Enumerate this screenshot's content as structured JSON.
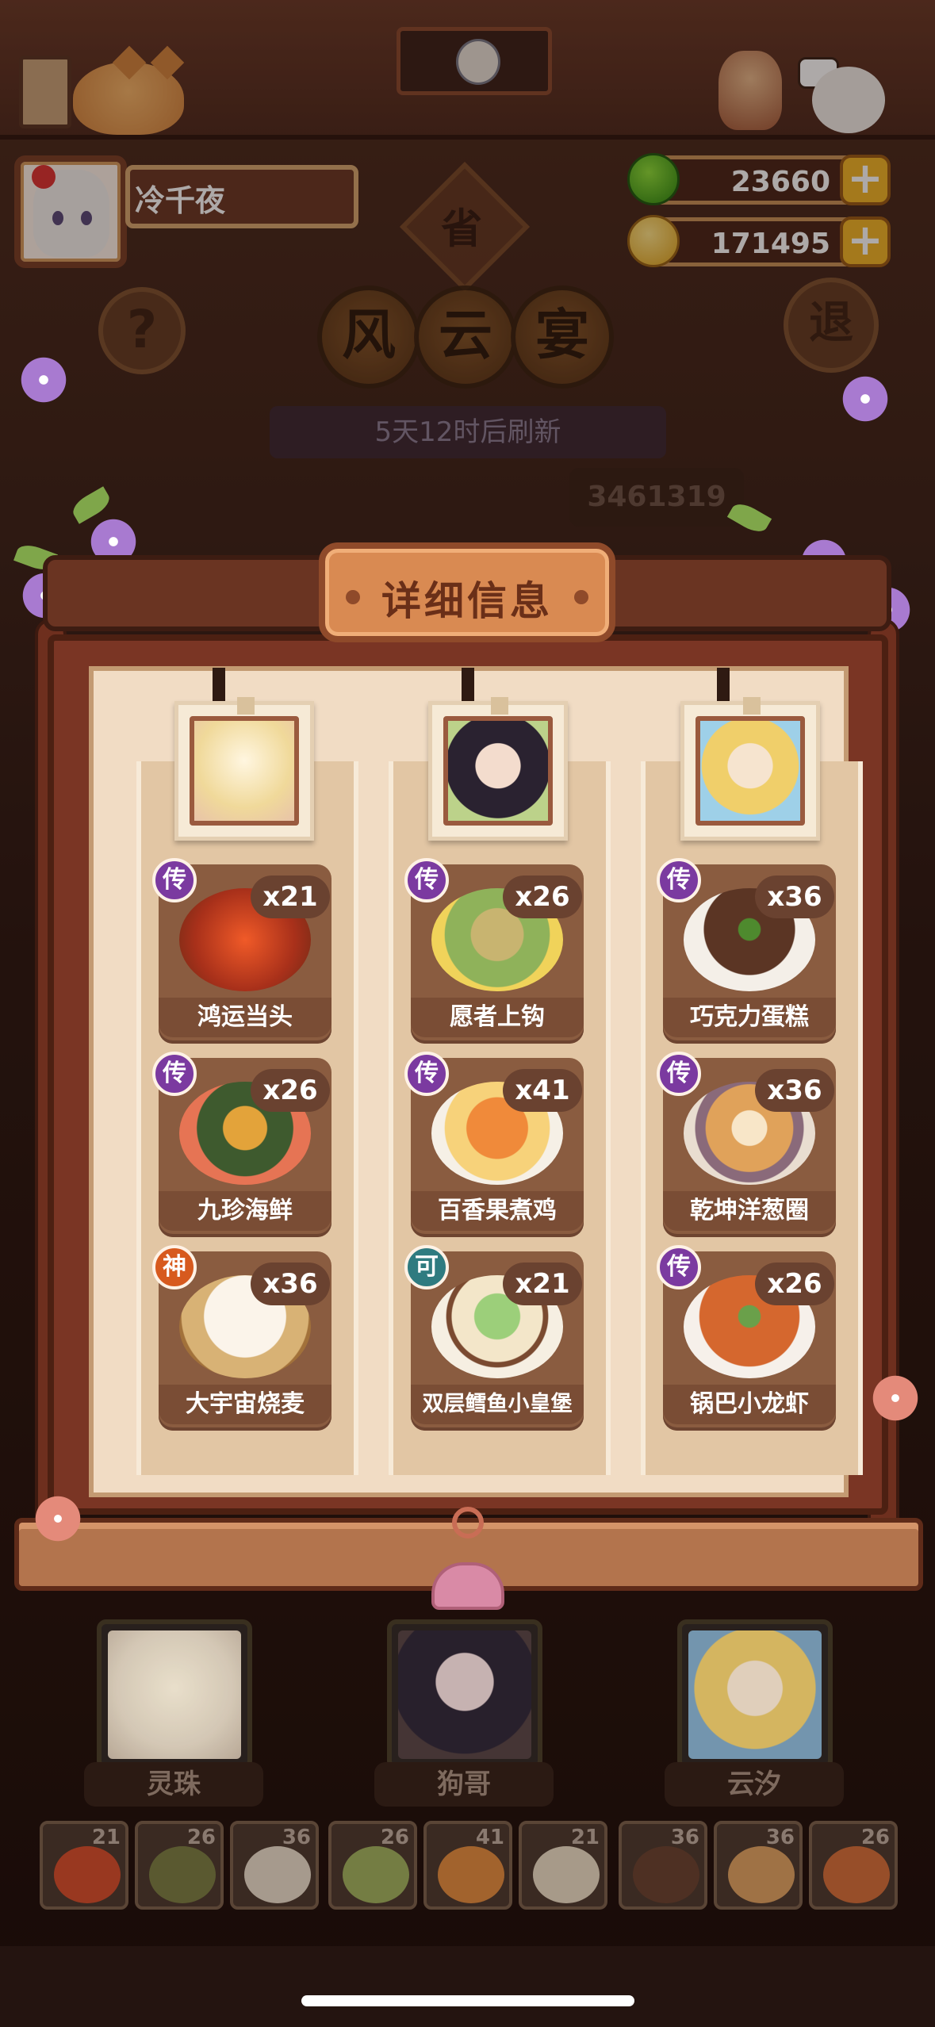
{
  "player": {
    "name": "冷千夜"
  },
  "currency": {
    "jade": "23660",
    "gold": "171495",
    "plus_glyph": "+"
  },
  "banquet": {
    "province": "省",
    "title_chars": [
      "风",
      "云",
      "宴"
    ],
    "refresh_text": "5天12时后刷新",
    "score": "3461319",
    "help_glyph": "?",
    "exit_glyph": "退"
  },
  "detail": {
    "title": "详细信息",
    "columns": [
      {
        "character": "灵珠",
        "dishes": [
          {
            "name": "鸿运当头",
            "badge": "传",
            "qty": "x21",
            "color": "#d8431f"
          },
          {
            "name": "九珍海鲜",
            "badge": "传",
            "qty": "x26",
            "color": "#6f7a3a"
          },
          {
            "name": "大宇宙烧麦",
            "badge": "神",
            "qty": "x36",
            "color": "#efe6d6"
          }
        ]
      },
      {
        "character": "狗哥",
        "dishes": [
          {
            "name": "愿者上钩",
            "badge": "传",
            "qty": "x26",
            "color": "#9bb65a"
          },
          {
            "name": "百香果煮鸡",
            "badge": "传",
            "qty": "x41",
            "color": "#e88a36"
          },
          {
            "name": "双层鳕鱼小皇堡",
            "badge": "可",
            "qty": "x21",
            "color": "#f0e6cf"
          }
        ]
      },
      {
        "character": "云汐",
        "dishes": [
          {
            "name": "巧克力蛋糕",
            "badge": "传",
            "qty": "x36",
            "color": "#5b3524"
          },
          {
            "name": "乾坤洋葱圈",
            "badge": "传",
            "qty": "x36",
            "color": "#e2a45e"
          },
          {
            "name": "锅巴小龙虾",
            "badge": "传",
            "qty": "x26",
            "color": "#d5672e"
          }
        ]
      }
    ]
  },
  "inventory": [
    {
      "count": "21",
      "color": "#d8431f"
    },
    {
      "count": "26",
      "color": "#6f7a3a"
    },
    {
      "count": "36",
      "color": "#efe6d6"
    },
    {
      "count": "26",
      "color": "#9bb65a"
    },
    {
      "count": "41",
      "color": "#e88a36"
    },
    {
      "count": "21",
      "color": "#f0e6cf"
    },
    {
      "count": "36",
      "color": "#5b3524"
    },
    {
      "count": "36",
      "color": "#e2a45e"
    },
    {
      "count": "26",
      "color": "#d5672e"
    }
  ],
  "colors": {
    "badge_chuan": "#7b3aa0",
    "badge_shen": "#d75a1e",
    "badge_ke": "#2f7b80",
    "plus_button": "#f2b628"
  }
}
